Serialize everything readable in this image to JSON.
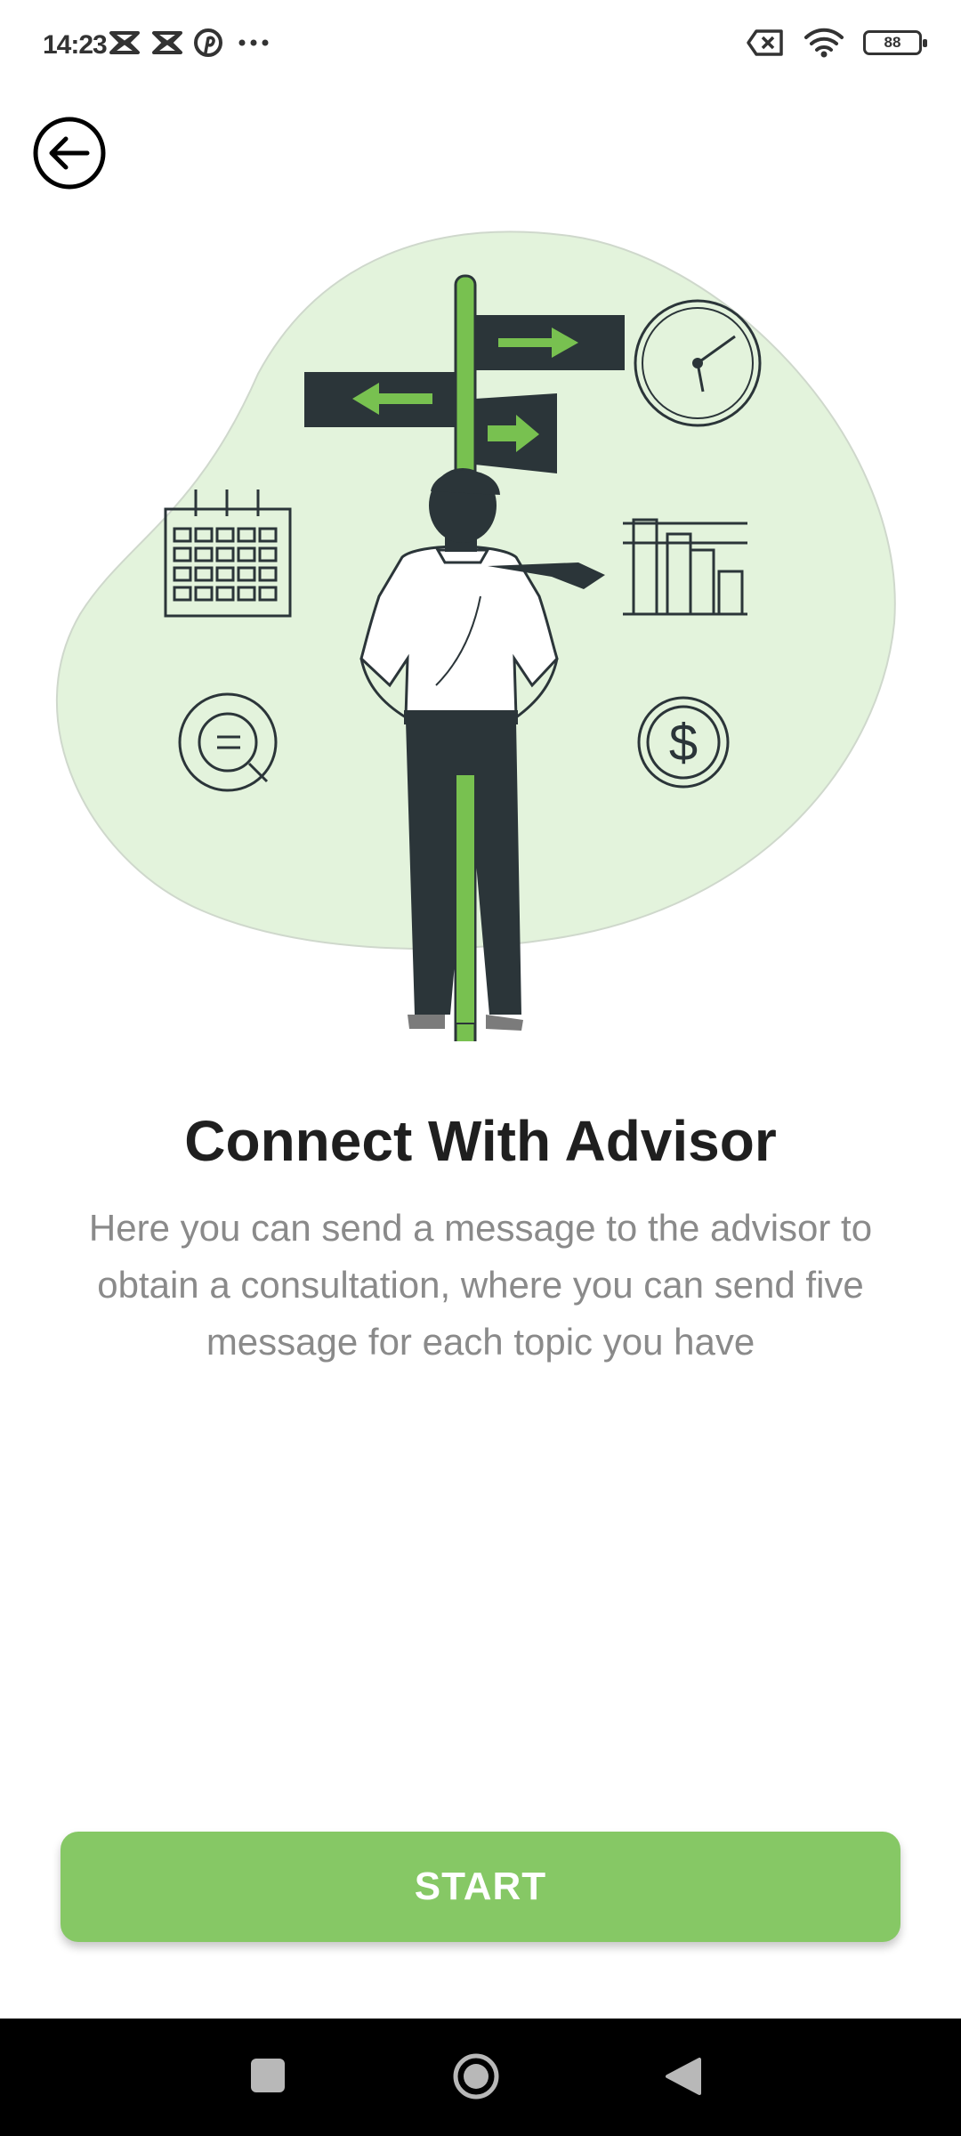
{
  "status_bar": {
    "time": "14:23",
    "left_icons": [
      "capcut-icon",
      "capcut-icon",
      "pinterest-icon",
      "more-dots-icon"
    ],
    "right_icons": [
      "sim-disabled-icon",
      "wifi-icon",
      "battery-icon"
    ],
    "battery_level": "88"
  },
  "header": {
    "back_icon": "back-arrow-circle-icon"
  },
  "illustration": {
    "name": "advisor-signpost-illustration",
    "accent": "#78c150",
    "blob": "#e3f3dc",
    "dark": "#2b3539"
  },
  "content": {
    "title": "Connect With Advisor",
    "description": "Here you can send a message to the advisor to obtain a consultation, where you can send five message for each topic you have"
  },
  "actions": {
    "start_label": "START",
    "start_color": "#86c865"
  },
  "nav_bar": {
    "icons": [
      "recents-square-icon",
      "home-circle-icon",
      "back-triangle-icon"
    ]
  }
}
